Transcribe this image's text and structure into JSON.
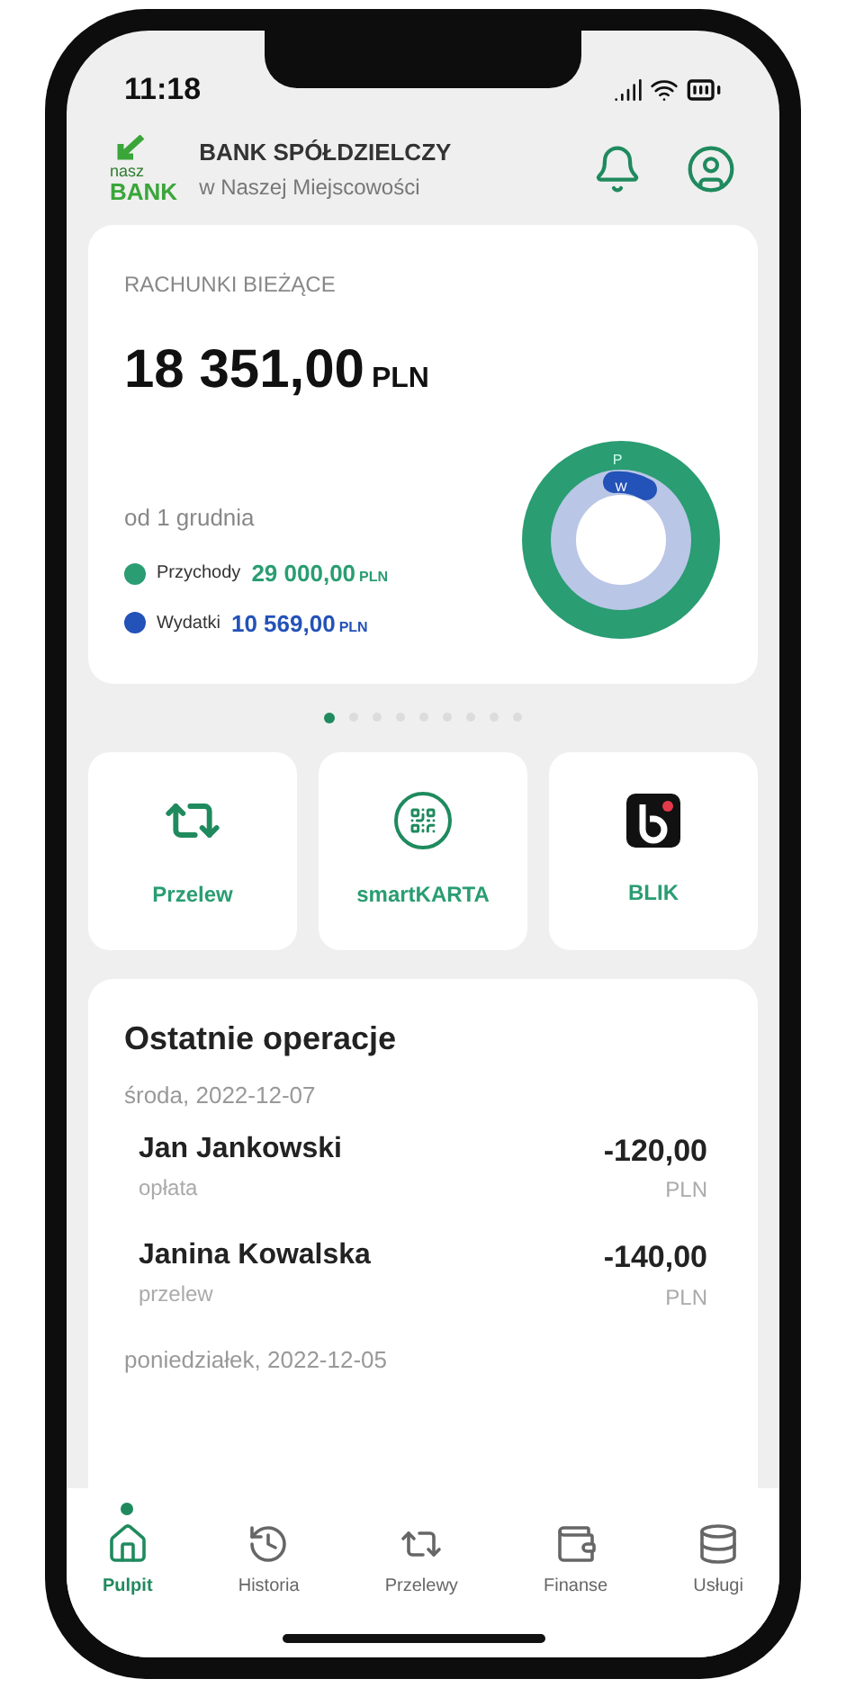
{
  "status_bar": {
    "time": "11:18"
  },
  "header": {
    "logo_small": "nasz",
    "logo_big": "BANK",
    "bank_name": "BANK SPÓŁDZIELCZY",
    "bank_location": "w Naszej Miejscowości"
  },
  "accounts_card": {
    "title": "RACHUNKI BIEŻĄCE",
    "balance": "18 351",
    "balance_decimals": ",00",
    "balance_currency": "PLN",
    "period": "od 1 grudnia",
    "legend": [
      {
        "label": "Przychody",
        "amount": "29 000",
        "decimals": ",00",
        "currency": "PLN",
        "color": "#2a9d72"
      },
      {
        "label": "Wydatki",
        "amount": "10 569",
        "decimals": ",00",
        "currency": "PLN",
        "color": "#2352b8"
      }
    ],
    "donut_labels": [
      "P",
      "W"
    ]
  },
  "pager": [
    {
      "selected": true
    },
    {
      "selected": false
    },
    {
      "selected": false
    },
    {
      "selected": false
    },
    {
      "selected": false
    },
    {
      "selected": false
    },
    {
      "selected": false
    },
    {
      "selected": false
    },
    {
      "selected": false
    }
  ],
  "shortcuts": [
    {
      "kind": "transfer",
      "label": "Przelew"
    },
    {
      "kind": "qr",
      "label": "smartKARTA"
    },
    {
      "kind": "blik",
      "label": "BLIK"
    }
  ],
  "recent": {
    "title": "Ostatnie operacje",
    "groups": [
      {
        "date": "środa, 2022-12-07",
        "items": [
          {
            "name": "Jan Jankowski",
            "type": "opłata",
            "amount": "-120,00",
            "currency": "PLN"
          },
          {
            "name": "Janina Kowalska",
            "type": "przelew",
            "amount": "-140,00",
            "currency": "PLN"
          }
        ]
      },
      {
        "date": "poniedziałek, 2022-12-05"
      }
    ]
  },
  "tab_bar": [
    {
      "kind": "home",
      "label": "Pulpit",
      "selected": true
    },
    {
      "kind": "history",
      "label": "Historia",
      "selected": false
    },
    {
      "kind": "transfer",
      "label": "Przelewy",
      "selected": false
    },
    {
      "kind": "wallet",
      "label": "Finanse",
      "selected": false
    },
    {
      "kind": "database",
      "label": "Usługi",
      "selected": false
    }
  ]
}
